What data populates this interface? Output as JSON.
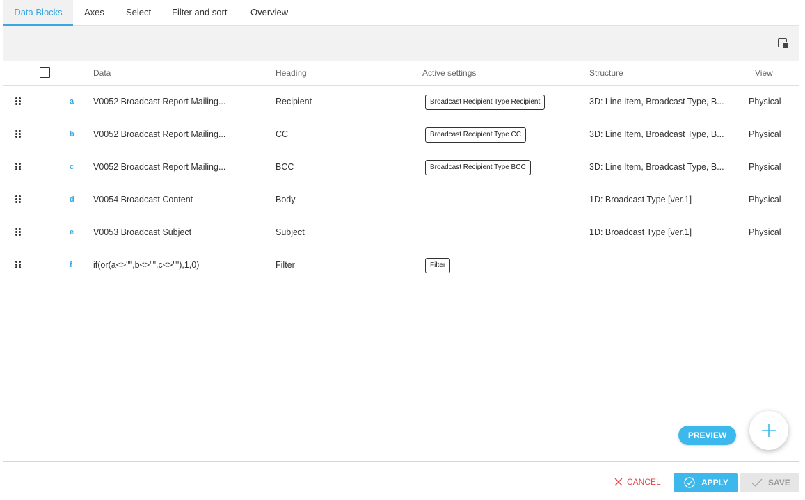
{
  "tabs": [
    {
      "label": "Data Blocks",
      "active": true
    },
    {
      "label": "Axes",
      "active": false
    },
    {
      "label": "Select",
      "active": false
    },
    {
      "label": "Filter and sort",
      "active": false
    },
    {
      "label": "Overview",
      "active": false
    }
  ],
  "toolbar": {
    "icon": "panel-toggle-icon"
  },
  "columns": {
    "data": "Data",
    "heading": "Heading",
    "active_settings": "Active settings",
    "structure": "Structure",
    "view": "View"
  },
  "rows": [
    {
      "letter": "a",
      "data": "V0052 Broadcast Report Mailing...",
      "heading": "Recipient",
      "setting": "Broadcast Recipient Type Recipient",
      "structure": "3D: Line Item, Broadcast Type, B...",
      "view": "Physical"
    },
    {
      "letter": "b",
      "data": "V0052 Broadcast Report Mailing...",
      "heading": "CC",
      "setting": "Broadcast Recipient Type CC",
      "structure": "3D: Line Item, Broadcast Type, B...",
      "view": "Physical"
    },
    {
      "letter": "c",
      "data": "V0052 Broadcast Report Mailing...",
      "heading": "BCC",
      "setting": "Broadcast Recipient Type BCC",
      "structure": "3D: Line Item, Broadcast Type, B...",
      "view": "Physical"
    },
    {
      "letter": "d",
      "data": "V0054 Broadcast Content",
      "heading": "Body",
      "setting": "",
      "structure": "1D: Broadcast Type [ver.1]",
      "view": "Physical"
    },
    {
      "letter": "e",
      "data": "V0053 Broadcast Subject",
      "heading": "Subject",
      "setting": "",
      "structure": "1D: Broadcast Type [ver.1]",
      "view": "Physical"
    },
    {
      "letter": "f",
      "data": "if(or(a<>\"\",b<>\"\",c<>\"\"),1,0)",
      "heading": "Filter",
      "setting": "Filter",
      "structure": "",
      "view": ""
    }
  ],
  "actions": {
    "preview": "PREVIEW",
    "cancel": "CANCEL",
    "apply": "APPLY",
    "save": "SAVE"
  },
  "colors": {
    "accent": "#3aa7df",
    "button": "#3db8ec",
    "cancel": "#e5474b",
    "disabled": "#e6e6e6"
  }
}
